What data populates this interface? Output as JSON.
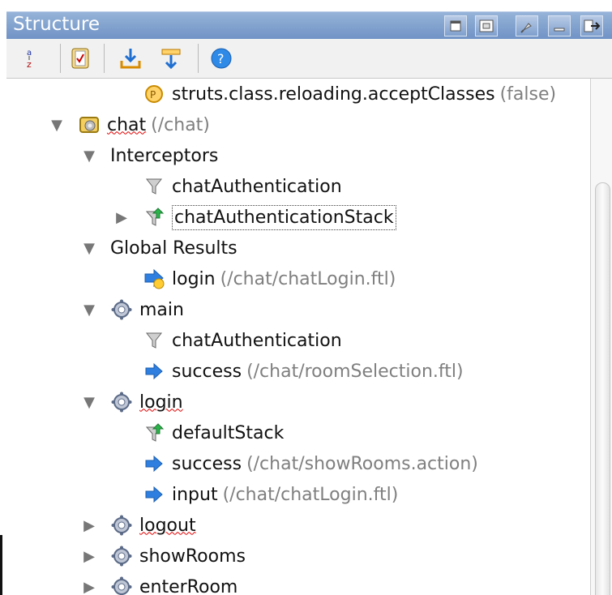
{
  "panel": {
    "title": "Structure",
    "window_buttons": [
      "maximize-icon",
      "restore-icon",
      "pin-icon",
      "minimize-icon",
      "close-panel-icon"
    ]
  },
  "toolbar": {
    "tools": [
      {
        "icon": "sort-az-icon"
      },
      {
        "icon": "validate-icon"
      },
      {
        "icon": "expand-all-icon"
      },
      {
        "icon": "collapse-all-icon"
      },
      {
        "icon": "help-icon"
      }
    ]
  },
  "tree": {
    "rows": [
      {
        "indent": 2,
        "arrow": "",
        "icon": "property-icon",
        "label": "struts.class.reloading.acceptClasses",
        "detail": "(false)",
        "underline": false,
        "focus": false
      },
      {
        "indent": 0,
        "arrow": "▼",
        "icon": "package-icon",
        "label": "chat",
        "detail": "(/chat)",
        "underline": true,
        "focus": false
      },
      {
        "indent": 1,
        "arrow": "▼",
        "icon": "",
        "label": "Interceptors",
        "detail": "",
        "underline": false,
        "focus": false
      },
      {
        "indent": 2,
        "arrow": "",
        "icon": "interceptor-icon",
        "label": "chatAuthentication",
        "detail": "",
        "underline": false,
        "focus": false
      },
      {
        "indent": 1.5,
        "arrow": "▶",
        "icon": "interceptor-stack-icon",
        "label": "chatAuthenticationStack",
        "detail": "",
        "underline": false,
        "focus": true
      },
      {
        "indent": 1,
        "arrow": "▼",
        "icon": "",
        "label": "Global Results",
        "detail": "",
        "underline": false,
        "focus": false
      },
      {
        "indent": 2,
        "arrow": "",
        "icon": "global-result-icon",
        "label": "login",
        "detail": "(/chat/chatLogin.ftl)",
        "underline": false,
        "focus": false
      },
      {
        "indent": 1,
        "arrow": "▼",
        "icon": "action-icon",
        "label": "main",
        "detail": "",
        "underline": false,
        "focus": false
      },
      {
        "indent": 2,
        "arrow": "",
        "icon": "interceptor-icon",
        "label": "chatAuthentication",
        "detail": "",
        "underline": false,
        "focus": false
      },
      {
        "indent": 2,
        "arrow": "",
        "icon": "result-icon",
        "label": "success",
        "detail": "(/chat/roomSelection.ftl)",
        "underline": false,
        "focus": false
      },
      {
        "indent": 1,
        "arrow": "▼",
        "icon": "action-icon",
        "label": "login",
        "detail": "",
        "underline": true,
        "focus": false
      },
      {
        "indent": 2,
        "arrow": "",
        "icon": "interceptor-stack-icon",
        "label": "defaultStack",
        "detail": "",
        "underline": false,
        "focus": false
      },
      {
        "indent": 2,
        "arrow": "",
        "icon": "result-icon",
        "label": "success",
        "detail": "(/chat/showRooms.action)",
        "underline": false,
        "focus": false
      },
      {
        "indent": 2,
        "arrow": "",
        "icon": "result-icon",
        "label": "input",
        "detail": "(/chat/chatLogin.ftl)",
        "underline": false,
        "focus": false
      },
      {
        "indent": 1,
        "arrow": "▶",
        "icon": "action-icon",
        "label": "logout",
        "detail": "",
        "underline": true,
        "focus": false
      },
      {
        "indent": 1,
        "arrow": "▶",
        "icon": "action-icon",
        "label": "showRooms",
        "detail": "",
        "underline": false,
        "focus": false
      },
      {
        "indent": 1,
        "arrow": "▶",
        "icon": "action-icon",
        "label": "enterRoom",
        "detail": "",
        "underline": false,
        "focus": false
      }
    ]
  }
}
